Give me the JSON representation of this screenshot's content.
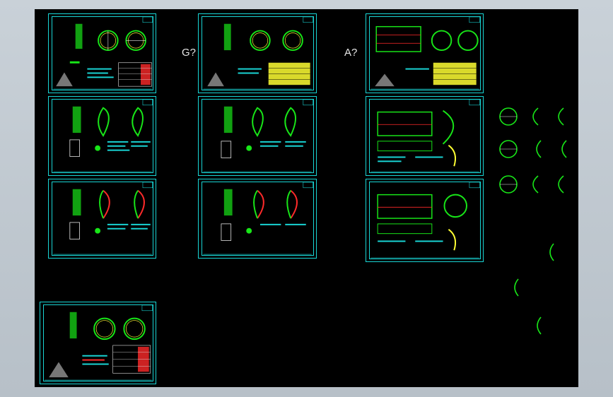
{
  "labels": {
    "middle": "G?",
    "right": "A?"
  },
  "colors": {
    "background": "#000000",
    "frame": "#19d6d6",
    "primary": "#18e618",
    "accent": "#ff2a2a",
    "highlight": "#ffff33",
    "text": "#e6e6e6"
  }
}
